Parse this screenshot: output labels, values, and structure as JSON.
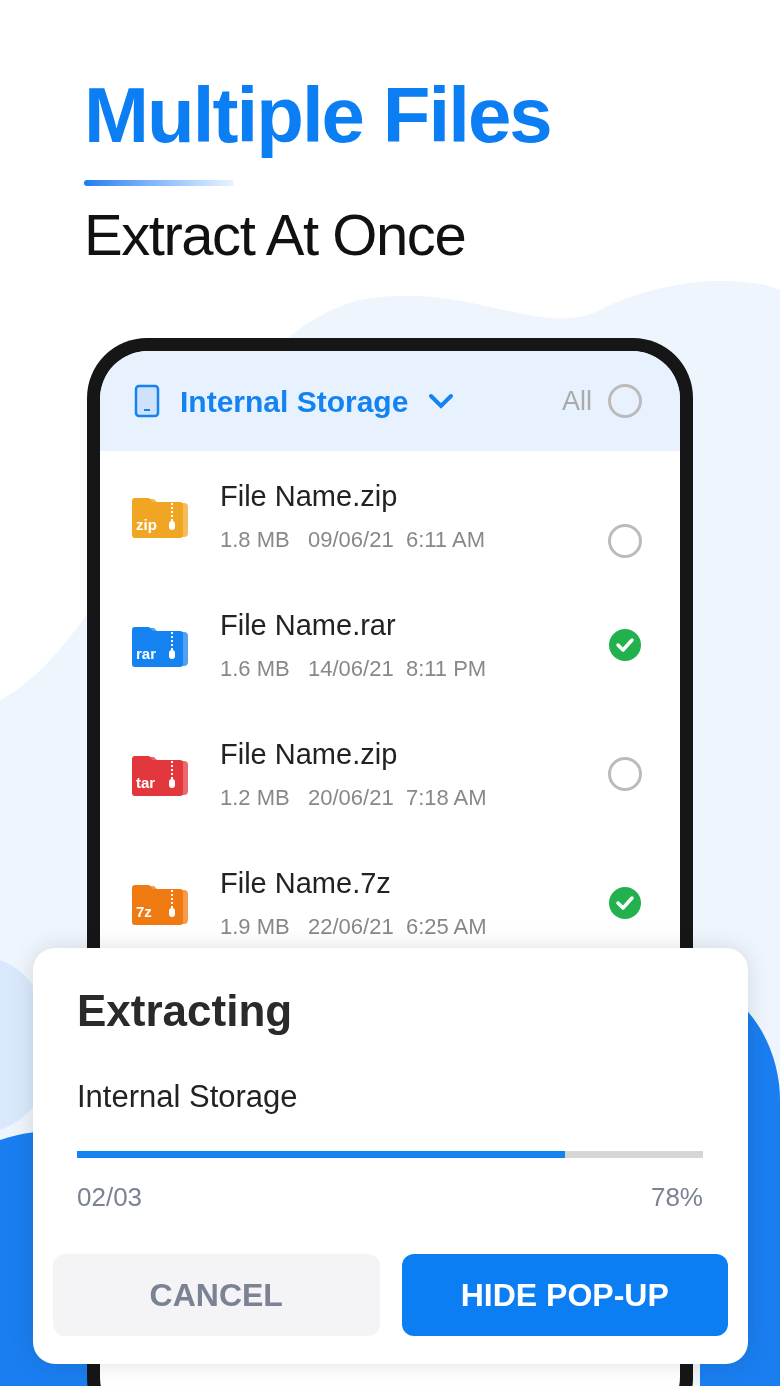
{
  "headline": {
    "title": "Multiple Files",
    "subtitle": "Extract At Once"
  },
  "storage_header": {
    "label": "Internal Storage",
    "all_label": "All",
    "all_selected": false
  },
  "files": [
    {
      "badge": "zip",
      "color": "#f0a623",
      "name": "File Name.zip",
      "size": "1.8 MB",
      "date": "09/06/21",
      "time": "6:11 AM",
      "selected": false
    },
    {
      "badge": "rar",
      "color": "#1482f0",
      "name": "File Name.rar",
      "size": "1.6 MB",
      "date": "14/06/21",
      "time": "8:11 PM",
      "selected": true
    },
    {
      "badge": "tar",
      "color": "#e2373d",
      "name": "File Name.zip",
      "size": "1.2 MB",
      "date": "20/06/21",
      "time": "7:18 AM",
      "selected": false
    },
    {
      "badge": "7z",
      "color": "#f07a12",
      "name": "File Name.7z",
      "size": "1.9 MB",
      "date": "22/06/21",
      "time": "6:25 AM",
      "selected": true
    }
  ],
  "dialog": {
    "title": "Extracting",
    "location": "Internal Storage",
    "level": 0.78,
    "count": "02/03",
    "percent": "78%",
    "buttons": [
      {
        "kind": "secondary",
        "label": "CANCEL"
      },
      {
        "kind": "primary",
        "label": "HIDE POP-UP"
      }
    ]
  }
}
